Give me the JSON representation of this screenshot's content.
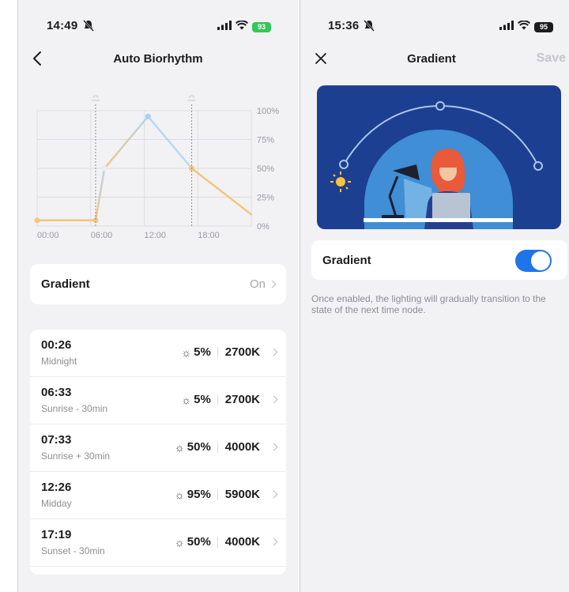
{
  "left_screen": {
    "status": {
      "time": "14:49",
      "battery": "93"
    },
    "nav": {
      "title": "Auto Biorhythm"
    },
    "chart_data": {
      "type": "line",
      "x_ticks": [
        "00:00",
        "06:00",
        "12:00",
        "18:00"
      ],
      "y_ticks": [
        "100%",
        "75%",
        "50%",
        "25%",
        "0%"
      ],
      "ylim": [
        0,
        100
      ],
      "x_unit": "hours",
      "points": [
        {
          "x": 0.0,
          "y": 5
        },
        {
          "x": 6.55,
          "y": 5
        },
        {
          "x": 7.55,
          "y": 50
        },
        {
          "x": 12.43,
          "y": 95
        },
        {
          "x": 17.32,
          "y": 50
        },
        {
          "x": 24.0,
          "y": 10
        }
      ]
    },
    "gradient_row": {
      "label": "Gradient",
      "value": "On"
    },
    "schedule": [
      {
        "time": "00:26",
        "subtitle": "Midnight",
        "brightness": "5%",
        "temperature": "2700K"
      },
      {
        "time": "06:33",
        "subtitle": "Sunrise - 30min",
        "brightness": "5%",
        "temperature": "2700K"
      },
      {
        "time": "07:33",
        "subtitle": "Sunrise + 30min",
        "brightness": "50%",
        "temperature": "4000K"
      },
      {
        "time": "12:26",
        "subtitle": "Midday",
        "brightness": "95%",
        "temperature": "5900K"
      },
      {
        "time": "17:19",
        "subtitle": "Sunset - 30min",
        "brightness": "50%",
        "temperature": "4000K"
      }
    ]
  },
  "right_screen": {
    "status": {
      "time": "15:36",
      "battery": "95"
    },
    "nav": {
      "title": "Gradient",
      "save": "Save"
    },
    "gradient_toggle": {
      "label": "Gradient",
      "on": true
    },
    "description": "Once enabled, the lighting will gradually transition to the state of the next time node."
  },
  "colors": {
    "accent_blue": "#1f74e8",
    "chart_warm": "#f3c57e",
    "chart_cool": "#a9d0ef",
    "battery_green": "#34c759",
    "illustration_bg": "#1d3f91"
  }
}
